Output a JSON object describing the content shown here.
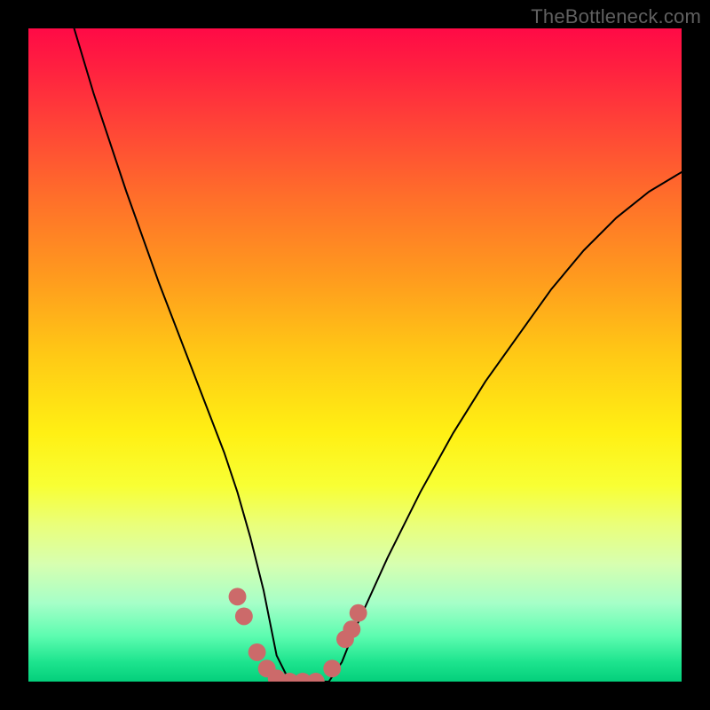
{
  "watermark": "TheBottleneck.com",
  "colors": {
    "frame": "#000000",
    "curve_stroke": "#000000",
    "marker_fill": "#cc6a6a",
    "marker_stroke": "#cc6a6a",
    "watermark_text": "#606060"
  },
  "chart_data": {
    "type": "line",
    "title": "",
    "xlabel": "",
    "ylabel": "",
    "xlim": [
      0,
      100
    ],
    "ylim": [
      0,
      100
    ],
    "grid": false,
    "legend": false,
    "series": [
      {
        "name": "curve",
        "x": [
          7,
          10,
          15,
          20,
          25,
          30,
          32,
          34,
          36,
          37,
          38,
          40,
          42,
          44,
          46,
          48,
          50,
          55,
          60,
          65,
          70,
          75,
          80,
          85,
          90,
          95,
          100
        ],
        "y": [
          100,
          90,
          75,
          61,
          48,
          35,
          29,
          22,
          14,
          9,
          4,
          0,
          0,
          0,
          0,
          3,
          8,
          19,
          29,
          38,
          46,
          53,
          60,
          66,
          71,
          75,
          78
        ]
      }
    ],
    "markers": [
      {
        "x": 32,
        "y": 13
      },
      {
        "x": 33,
        "y": 10
      },
      {
        "x": 35,
        "y": 4.5
      },
      {
        "x": 36.5,
        "y": 2
      },
      {
        "x": 38,
        "y": 0.5
      },
      {
        "x": 40,
        "y": 0
      },
      {
        "x": 42,
        "y": 0
      },
      {
        "x": 44,
        "y": 0
      },
      {
        "x": 46.5,
        "y": 2
      },
      {
        "x": 48.5,
        "y": 6.5
      },
      {
        "x": 49.5,
        "y": 8
      },
      {
        "x": 50.5,
        "y": 10.5
      }
    ],
    "marker_radius": 1.35
  }
}
